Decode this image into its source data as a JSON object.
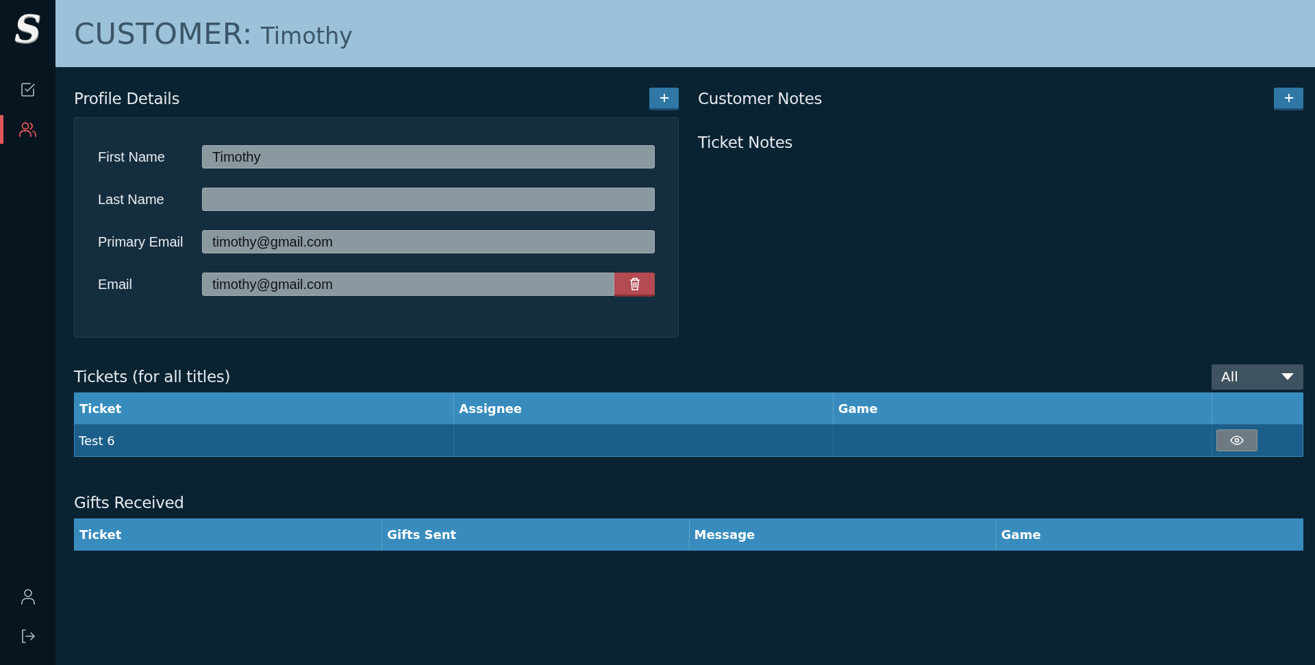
{
  "sidebar": {
    "logo": "S",
    "nav": [
      {
        "kind": "tasks",
        "selected": false
      },
      {
        "kind": "customers",
        "selected": true
      }
    ],
    "footer": [
      {
        "kind": "profile"
      },
      {
        "kind": "logout"
      }
    ]
  },
  "header": {
    "title": "CUSTOMER:",
    "name": "Timothy"
  },
  "profile": {
    "heading": "Profile Details",
    "fields": [
      {
        "label": "First Name",
        "value": "Timothy",
        "removable": false
      },
      {
        "label": "Last Name",
        "removable": false
      },
      {
        "label": "Primary Email",
        "value": "timothy@gmail.com",
        "removable": false
      },
      {
        "label": "Email",
        "value": "timothy@gmail.com",
        "removable": true
      }
    ]
  },
  "notes": {
    "heading": "Customer Notes",
    "subheading": "Ticket Notes"
  },
  "tickets": {
    "heading": "Tickets (for all titles)",
    "filter": "All",
    "columns": [
      "Ticket",
      "Assignee",
      "Game"
    ],
    "rows": [
      {
        "cells": [
          "Test 6"
        ]
      }
    ]
  },
  "gifts": {
    "heading": "Gifts Received",
    "columns": [
      "Ticket",
      "Gifts Sent",
      "Message",
      "Game"
    ]
  }
}
